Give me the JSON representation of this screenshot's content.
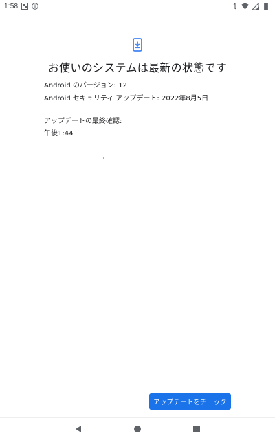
{
  "status_bar": {
    "time": "1:58",
    "icons_left": [
      "photo-icon",
      "info-icon"
    ],
    "icons_right": [
      "sync-icon",
      "wifi-icon",
      "signal-icon",
      "battery-icon"
    ]
  },
  "main": {
    "icon": "system-update-icon",
    "title": "お使いのシステムは最新の状態です",
    "android_version": "Android のバージョン: 12",
    "security_update": "Android セキュリティ アップデート: 2022年8月5日",
    "last_check_label": "アップデートの最終確認:",
    "last_check_time": "午後1:44"
  },
  "actions": {
    "check_update_label": "アップデートをチェック"
  },
  "nav_bar": {
    "buttons": [
      "back-icon",
      "home-icon",
      "recents-icon"
    ]
  },
  "colors": {
    "accent": "#1a73e8",
    "icon_blue": "#4285f4",
    "text": "#202124"
  }
}
